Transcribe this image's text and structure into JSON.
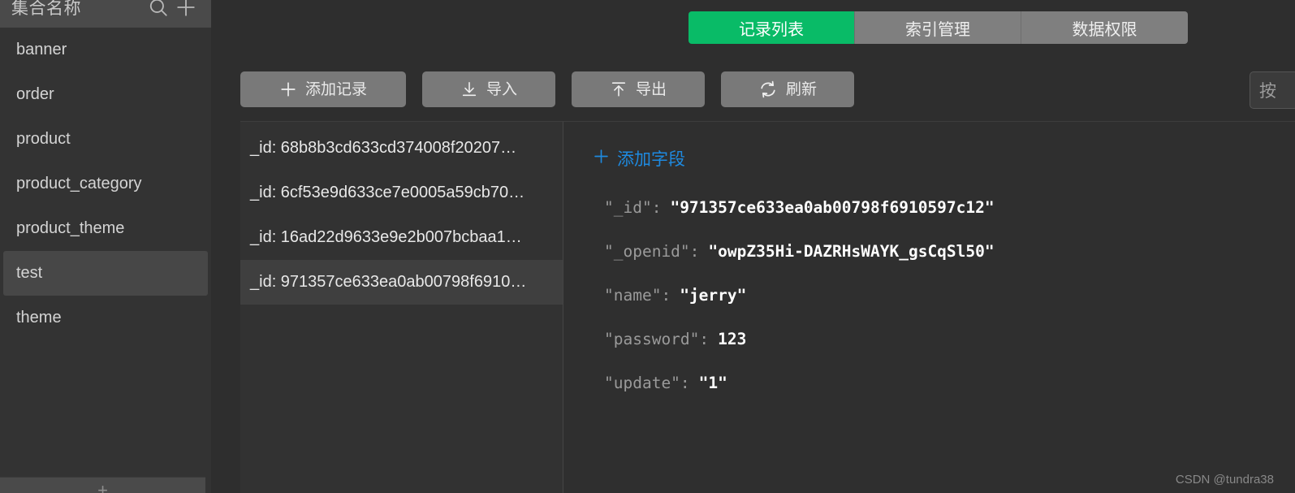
{
  "sidebar": {
    "title": "集合名称",
    "search_icon": "search-icon",
    "add_icon": "plus-icon",
    "collections": [
      {
        "label": "banner",
        "selected": false
      },
      {
        "label": "order",
        "selected": false
      },
      {
        "label": "product",
        "selected": false
      },
      {
        "label": "product_category",
        "selected": false
      },
      {
        "label": "product_theme",
        "selected": false
      },
      {
        "label": "test",
        "selected": true
      },
      {
        "label": "theme",
        "selected": false
      }
    ],
    "footer_add_icon": "plus-icon"
  },
  "tabs": [
    {
      "label": "记录列表",
      "active": true
    },
    {
      "label": "索引管理",
      "active": false
    },
    {
      "label": "数据权限",
      "active": false
    }
  ],
  "toolbar": {
    "add_record": {
      "label": "添加记录",
      "icon": "plus-icon"
    },
    "import": {
      "label": "导入",
      "icon": "download-icon"
    },
    "export": {
      "label": "导出",
      "icon": "upload-icon"
    },
    "refresh": {
      "label": "刷新",
      "icon": "refresh-icon"
    }
  },
  "edge_button": {
    "label": "按"
  },
  "records": [
    {
      "label": "_id: 68b8b3cd633cd374008f20207…",
      "selected": false
    },
    {
      "label": "_id: 6cf53e9d633ce7e0005a59cb70…",
      "selected": false
    },
    {
      "label": "_id: 16ad22d9633e9e2b007bcbaa1…",
      "selected": false
    },
    {
      "label": "_id: 971357ce633ea0ab00798f6910…",
      "selected": true
    }
  ],
  "detail": {
    "add_field_label": "添加字段",
    "add_field_icon": "plus-icon",
    "fields": [
      {
        "key": "\"_id\"",
        "colon": ":",
        "value": "\"971357ce633ea0ab00798f6910597c12\""
      },
      {
        "key": "\"_openid\"",
        "colon": ":",
        "value": "\"owpZ35Hi-DAZRHsWAYK_gsCqSl50\""
      },
      {
        "key": "\"name\"",
        "colon": ":",
        "value": "\"jerry\""
      },
      {
        "key": "\"password\"",
        "colon": ":",
        "value": "123"
      },
      {
        "key": "\"update\"",
        "colon": ":",
        "value": "\"1\""
      }
    ]
  },
  "watermark": "CSDN @tundra38",
  "colors": {
    "accent_green": "#09bb67",
    "link_blue": "#1e8ae0",
    "sidebar_bg": "#333333",
    "main_bg": "#2e2e2e",
    "button_bg": "#797979"
  }
}
